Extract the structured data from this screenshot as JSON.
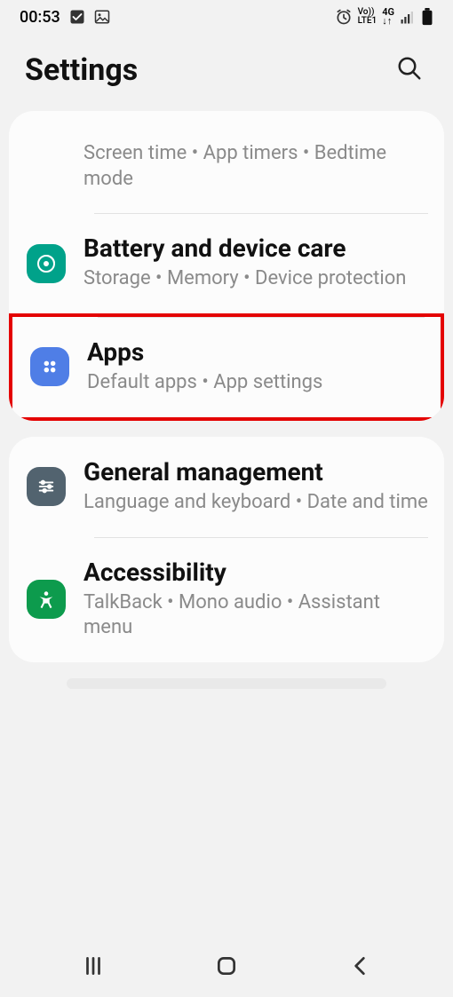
{
  "status": {
    "time": "00:53",
    "net_top": "Vo))",
    "net_bottom": "LTE1",
    "net_gen": "4G"
  },
  "header": {
    "title": "Settings"
  },
  "groups": [
    {
      "items": [
        {
          "title": "",
          "subtitle": "Screen time  •  App timers  •  Bedtime mode",
          "icon": null
        },
        {
          "title": "Battery and device care",
          "subtitle": "Storage  •  Memory  •  Device protection",
          "icon": "device-care",
          "icon_color": "teal"
        },
        {
          "title": "Apps",
          "subtitle": "Default apps  •  App settings",
          "icon": "apps",
          "icon_color": "blue",
          "highlighted": true
        }
      ]
    },
    {
      "items": [
        {
          "title": "General management",
          "subtitle": "Language and keyboard  •  Date and time",
          "icon": "sliders",
          "icon_color": "slate"
        },
        {
          "title": "Accessibility",
          "subtitle": "TalkBack  •  Mono audio  •  Assistant menu",
          "icon": "accessibility",
          "icon_color": "green"
        }
      ]
    }
  ]
}
